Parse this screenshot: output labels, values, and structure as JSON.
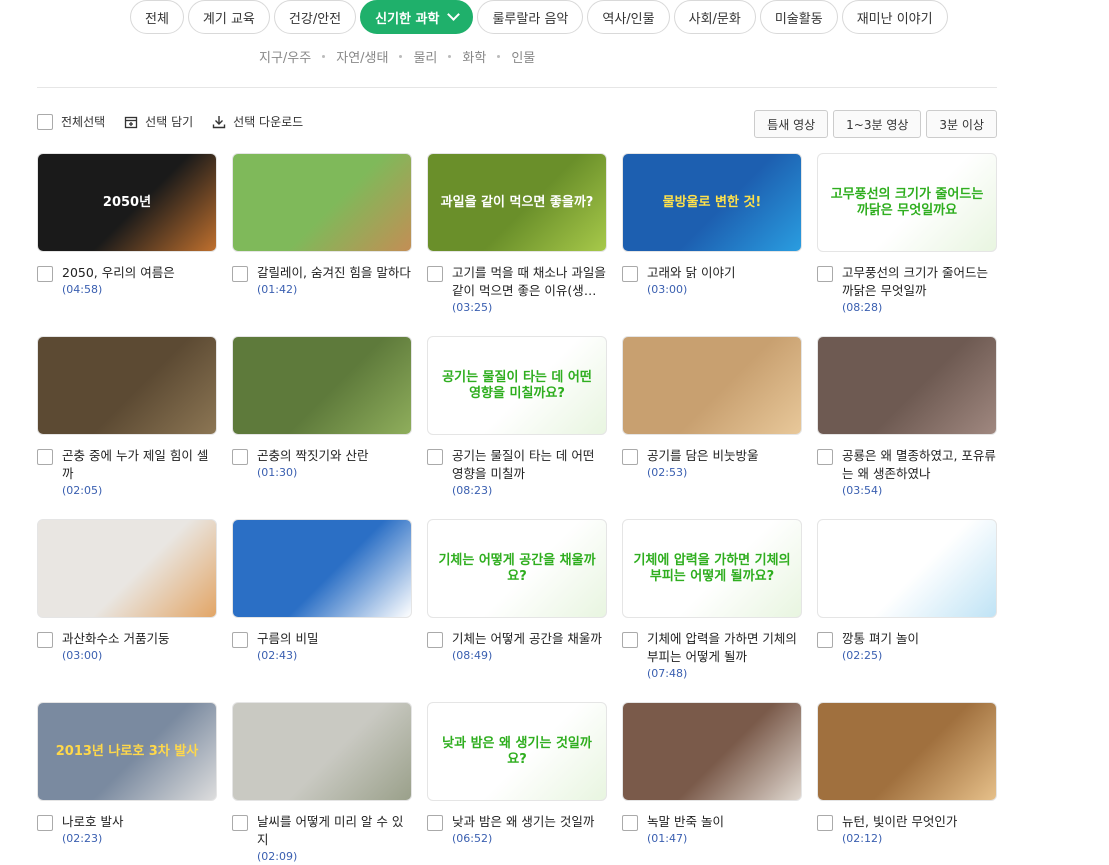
{
  "tabs": [
    {
      "label": "전체",
      "active": false
    },
    {
      "label": "계기 교육",
      "active": false
    },
    {
      "label": "건강/안전",
      "active": false
    },
    {
      "label": "신기한 과학",
      "active": true
    },
    {
      "label": "룰루랄라 음악",
      "active": false
    },
    {
      "label": "역사/인물",
      "active": false
    },
    {
      "label": "사회/문화",
      "active": false
    },
    {
      "label": "미술활동",
      "active": false
    },
    {
      "label": "재미난 이야기",
      "active": false
    }
  ],
  "subtabs": [
    "지구/우주",
    "자연/생태",
    "물리",
    "화학",
    "인물"
  ],
  "toolbar": {
    "select_all": "전체선택",
    "add_selected": "선택 담기",
    "download_selected": "선택 다운로드"
  },
  "filters": [
    "틈새 영상",
    "1~3분 영상",
    "3분 이상"
  ],
  "videos": [
    {
      "title": "2050, 우리의 여름은",
      "duration": "(04:58)",
      "thumb_text": "2050년",
      "thumb_bg": "#1a1a1a",
      "thumb_accent": "#c0702e",
      "thumb_fg": "#ffffff"
    },
    {
      "title": "갈릴레이, 숨겨진 힘을 말하다",
      "duration": "(01:42)",
      "thumb_text": "",
      "thumb_bg": "#7fb95a",
      "thumb_accent": "#c38e55",
      "thumb_fg": "#ffffff"
    },
    {
      "title": "고기를 먹을 때 채소나 과일을 같이 먹으면 좋은 이유(생생과학)",
      "duration": "(03:25)",
      "thumb_text": "과일을 같이 먹으면 좋을까?",
      "thumb_bg": "#6a8f2a",
      "thumb_accent": "#a7c94a",
      "thumb_fg": "#ffffff"
    },
    {
      "title": "고래와 닭 이야기",
      "duration": "(03:00)",
      "thumb_text": "물방울로 변한 것!",
      "thumb_bg": "#1d5fb0",
      "thumb_accent": "#2a9de0",
      "thumb_fg": "#ffe14a"
    },
    {
      "title": "고무풍선의 크기가 줄어드는 까닭은 무엇일까",
      "duration": "(08:28)",
      "thumb_text": "고무풍선의 크기가 줄어드는 까닭은 무엇일까요",
      "thumb_bg": "#ffffff",
      "thumb_accent": "#e8f5e0",
      "thumb_fg": "#2fae1f"
    },
    {
      "title": "곤충 중에 누가 제일 힘이 셀까",
      "duration": "(02:05)",
      "thumb_text": "",
      "thumb_bg": "#5c4a33",
      "thumb_accent": "#8c7654",
      "thumb_fg": "#ffffff"
    },
    {
      "title": "곤충의 짝짓기와 산란",
      "duration": "(01:30)",
      "thumb_text": "",
      "thumb_bg": "#5e7a3b",
      "thumb_accent": "#8fae5c",
      "thumb_fg": "#ffffff"
    },
    {
      "title": "공기는 물질이 타는 데 어떤 영향을 미칠까",
      "duration": "(08:23)",
      "thumb_text": "공기는 물질이 타는 데 어떤 영향을 미칠까요?",
      "thumb_bg": "#ffffff",
      "thumb_accent": "#e8f5e0",
      "thumb_fg": "#2fae1f"
    },
    {
      "title": "공기를 담은 비눗방울",
      "duration": "(02:53)",
      "thumb_text": "",
      "thumb_bg": "#c8a070",
      "thumb_accent": "#e8c89a",
      "thumb_fg": "#ffffff"
    },
    {
      "title": "공룡은 왜 멸종하였고, 포유류는 왜 생존하였나",
      "duration": "(03:54)",
      "thumb_text": "",
      "thumb_bg": "#6e5a52",
      "thumb_accent": "#a08880",
      "thumb_fg": "#ffffff"
    },
    {
      "title": "과산화수소 거품기둥",
      "duration": "(03:00)",
      "thumb_text": "",
      "thumb_bg": "#e9e6e2",
      "thumb_accent": "#e2a566",
      "thumb_fg": "#ffffff"
    },
    {
      "title": "구름의 비밀",
      "duration": "(02:43)",
      "thumb_text": "",
      "thumb_bg": "#2b6fc5",
      "thumb_accent": "#ffffff",
      "thumb_fg": "#ffffff"
    },
    {
      "title": "기체는 어떻게 공간을 채울까",
      "duration": "(08:49)",
      "thumb_text": "기체는 어떻게 공간을 채울까요?",
      "thumb_bg": "#ffffff",
      "thumb_accent": "#e8f5e0",
      "thumb_fg": "#2fae1f"
    },
    {
      "title": "기체에 압력을 가하면 기체의 부피는 어떻게 될까",
      "duration": "(07:48)",
      "thumb_text": "기체에 압력을 가하면 기체의 부피는 어떻게 될까요?",
      "thumb_bg": "#ffffff",
      "thumb_accent": "#e8f5e0",
      "thumb_fg": "#2fae1f"
    },
    {
      "title": "깡통 펴기 놀이",
      "duration": "(02:25)",
      "thumb_text": "",
      "thumb_bg": "#ffffff",
      "thumb_accent": "#bfe3f5",
      "thumb_fg": "#3a3a3a"
    },
    {
      "title": "나로호 발사",
      "duration": "(02:23)",
      "thumb_text": "2013년 나로호 3차 발사",
      "thumb_bg": "#7a8aa0",
      "thumb_accent": "#dddddd",
      "thumb_fg": "#ffd84a"
    },
    {
      "title": "날씨를 어떻게 미리 알 수 있지",
      "duration": "(02:09)",
      "thumb_text": "",
      "thumb_bg": "#c9c9c2",
      "thumb_accent": "#9aa08a",
      "thumb_fg": "#ffffff"
    },
    {
      "title": "낮과 밤은 왜 생기는 것일까",
      "duration": "(06:52)",
      "thumb_text": "낮과 밤은 왜 생기는 것일까요?",
      "thumb_bg": "#ffffff",
      "thumb_accent": "#e8f5e0",
      "thumb_fg": "#2fae1f"
    },
    {
      "title": "녹말 반죽 놀이",
      "duration": "(01:47)",
      "thumb_text": "",
      "thumb_bg": "#7a5a4a",
      "thumb_accent": "#e0d8d0",
      "thumb_fg": "#ffffff"
    },
    {
      "title": "뉴턴, 빛이란 무엇인가",
      "duration": "(02:12)",
      "thumb_text": "",
      "thumb_bg": "#a0703e",
      "thumb_accent": "#e6c08a",
      "thumb_fg": "#ffffff"
    }
  ]
}
